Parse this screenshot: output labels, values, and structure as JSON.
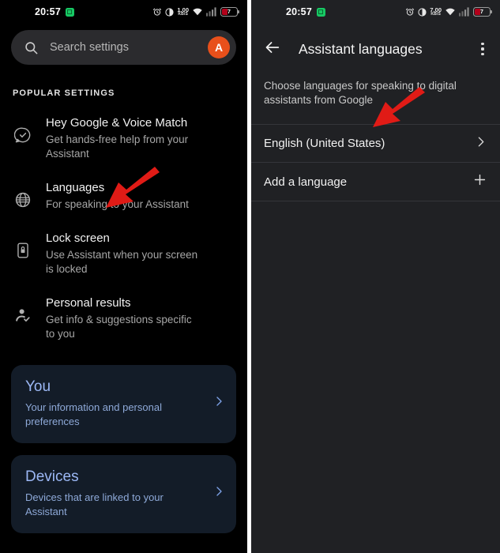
{
  "left_screen": {
    "status_bar": {
      "time": "20:57",
      "data_rate_value": "1.00",
      "data_rate_unit": "KB/S",
      "battery_level": "7",
      "icons": [
        "alarm-icon",
        "dnd-icon",
        "data-rate-icon",
        "wifi-icon",
        "signal-icon",
        "battery-icon"
      ]
    },
    "search": {
      "placeholder": "Search settings",
      "avatar_initial": "A"
    },
    "section_title": "POPULAR SETTINGS",
    "settings": [
      {
        "icon": "voice-match-check-icon",
        "title": "Hey Google & Voice Match",
        "subtitle": "Get hands-free help from your Assistant"
      },
      {
        "icon": "globe-icon",
        "title": "Languages",
        "subtitle": "For speaking to your Assistant"
      },
      {
        "icon": "phone-lock-icon",
        "title": "Lock screen",
        "subtitle": "Use Assistant when your screen is locked"
      },
      {
        "icon": "person-check-icon",
        "title": "Personal results",
        "subtitle": "Get info & suggestions specific to you"
      }
    ],
    "cards": [
      {
        "title": "You",
        "subtitle": "Your information and personal preferences"
      },
      {
        "title": "Devices",
        "subtitle": "Devices that are linked to your Assistant"
      }
    ]
  },
  "right_screen": {
    "status_bar": {
      "time": "20:57",
      "data_rate_value": "7.00",
      "data_rate_unit": "KB/S",
      "battery_level": "7"
    },
    "appbar": {
      "back_icon": "back-arrow-icon",
      "title": "Assistant languages",
      "overflow_icon": "more-vertical-icon"
    },
    "description": "Choose languages for speaking to digital assistants from Google",
    "languages": [
      {
        "label": "English (United States)",
        "trailing_icon": "chevron-right-icon"
      },
      {
        "label": "Add a language",
        "trailing_icon": "plus-icon"
      }
    ]
  },
  "annotations": {
    "arrow_color": "#e01b16",
    "arrows": [
      {
        "name": "arrow-pointing-to-languages",
        "target": "Languages"
      },
      {
        "name": "arrow-pointing-to-english-united-states",
        "target": "English (United States)"
      }
    ]
  }
}
